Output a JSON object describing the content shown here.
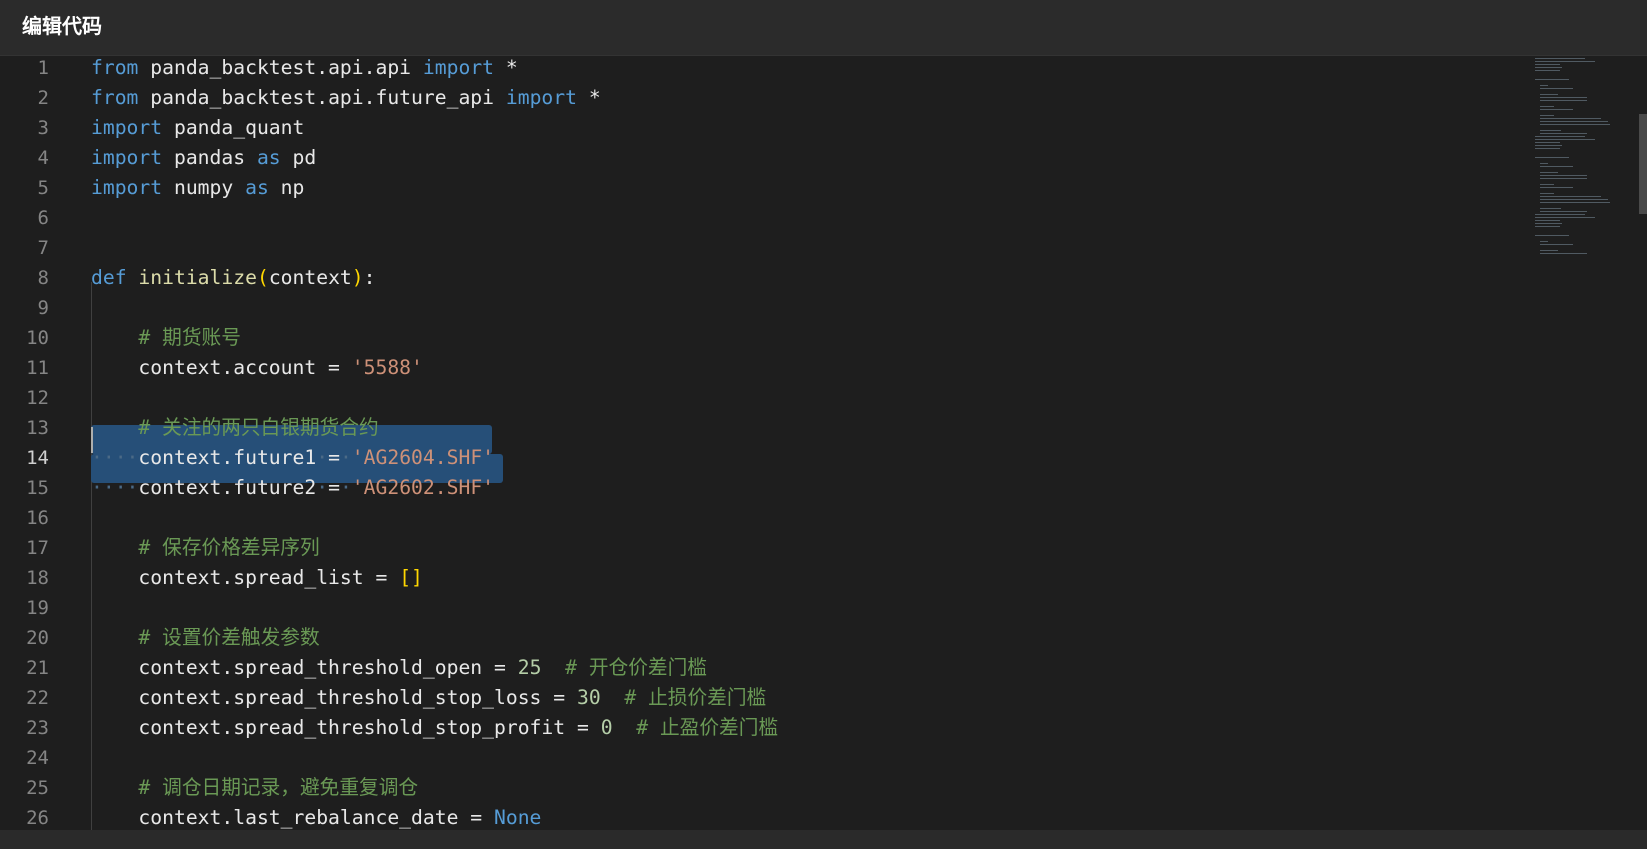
{
  "window": {
    "title": "编辑代码"
  },
  "editor": {
    "active_line": 14,
    "lines": [
      {
        "n": "1",
        "tokens": [
          [
            "kw",
            "from"
          ],
          [
            "id",
            " panda_backtest.api.api "
          ],
          [
            "kw",
            "import"
          ],
          [
            "id",
            " *"
          ]
        ]
      },
      {
        "n": "2",
        "tokens": [
          [
            "kw",
            "from"
          ],
          [
            "id",
            " panda_backtest.api.future_api "
          ],
          [
            "kw",
            "import"
          ],
          [
            "id",
            " *"
          ]
        ]
      },
      {
        "n": "3",
        "tokens": [
          [
            "kw",
            "import"
          ],
          [
            "id",
            " panda_quant"
          ]
        ]
      },
      {
        "n": "4",
        "tokens": [
          [
            "kw",
            "import"
          ],
          [
            "id",
            " pandas "
          ],
          [
            "kw",
            "as"
          ],
          [
            "id",
            " pd"
          ]
        ]
      },
      {
        "n": "5",
        "tokens": [
          [
            "kw",
            "import"
          ],
          [
            "id",
            " numpy "
          ],
          [
            "kw",
            "as"
          ],
          [
            "id",
            " np"
          ]
        ]
      },
      {
        "n": "6",
        "tokens": []
      },
      {
        "n": "7",
        "tokens": []
      },
      {
        "n": "8",
        "tokens": [
          [
            "kw",
            "def"
          ],
          [
            "id",
            " "
          ],
          [
            "fn",
            "initialize"
          ],
          [
            "br",
            "("
          ],
          [
            "id",
            "context"
          ],
          [
            "br",
            ")"
          ],
          [
            "id",
            ":"
          ]
        ]
      },
      {
        "n": "9",
        "tokens": []
      },
      {
        "n": "10",
        "tokens": [
          [
            "id",
            "    "
          ],
          [
            "com",
            "# 期货账号"
          ]
        ]
      },
      {
        "n": "11",
        "tokens": [
          [
            "id",
            "    context.account = "
          ],
          [
            "str",
            "'5588'"
          ]
        ]
      },
      {
        "n": "12",
        "tokens": []
      },
      {
        "n": "13",
        "tokens": [
          [
            "id",
            "    "
          ],
          [
            "com",
            "# 关注的两只白银期货合约"
          ]
        ]
      },
      {
        "n": "14",
        "tokens": [
          [
            "dots",
            "····"
          ],
          [
            "id",
            "context.future1"
          ],
          [
            "dots",
            "·"
          ],
          [
            "id",
            "="
          ],
          [
            "dots",
            "·"
          ],
          [
            "str",
            "'AG2604.SHF'"
          ]
        ]
      },
      {
        "n": "15",
        "tokens": [
          [
            "dots",
            "····"
          ],
          [
            "id",
            "context.future2"
          ],
          [
            "dots",
            "·"
          ],
          [
            "id",
            "="
          ],
          [
            "dots",
            "·"
          ],
          [
            "str",
            "'AG2602.SHF'"
          ]
        ]
      },
      {
        "n": "16",
        "tokens": []
      },
      {
        "n": "17",
        "tokens": [
          [
            "id",
            "    "
          ],
          [
            "com",
            "# 保存价格差异序列"
          ]
        ]
      },
      {
        "n": "18",
        "tokens": [
          [
            "id",
            "    context.spread_list = "
          ],
          [
            "br",
            "[]"
          ]
        ]
      },
      {
        "n": "19",
        "tokens": []
      },
      {
        "n": "20",
        "tokens": [
          [
            "id",
            "    "
          ],
          [
            "com",
            "# 设置价差触发参数"
          ]
        ]
      },
      {
        "n": "21",
        "tokens": [
          [
            "id",
            "    context.spread_threshold_open = "
          ],
          [
            "num",
            "25"
          ],
          [
            "id",
            "  "
          ],
          [
            "com",
            "# 开仓价差门槛"
          ]
        ]
      },
      {
        "n": "22",
        "tokens": [
          [
            "id",
            "    context.spread_threshold_stop_loss = "
          ],
          [
            "num",
            "30"
          ],
          [
            "id",
            "  "
          ],
          [
            "com",
            "# 止损价差门槛"
          ]
        ]
      },
      {
        "n": "23",
        "tokens": [
          [
            "id",
            "    context.spread_threshold_stop_profit = "
          ],
          [
            "num",
            "0"
          ],
          [
            "id",
            "  "
          ],
          [
            "com",
            "# 止盈价差门槛"
          ]
        ]
      },
      {
        "n": "24",
        "tokens": []
      },
      {
        "n": "25",
        "tokens": [
          [
            "id",
            "    "
          ],
          [
            "com",
            "# 调仓日期记录，避免重复调仓"
          ]
        ]
      },
      {
        "n": "26",
        "tokens": [
          [
            "id",
            "    context.last_rebalance_date = "
          ],
          [
            "kw",
            "None"
          ]
        ]
      }
    ]
  },
  "colors": {
    "keyword": "#569cd6",
    "string": "#ce9178",
    "number": "#b5cea8",
    "comment": "#6a9955",
    "selection": "#264f78",
    "background": "#1e1e1e"
  }
}
